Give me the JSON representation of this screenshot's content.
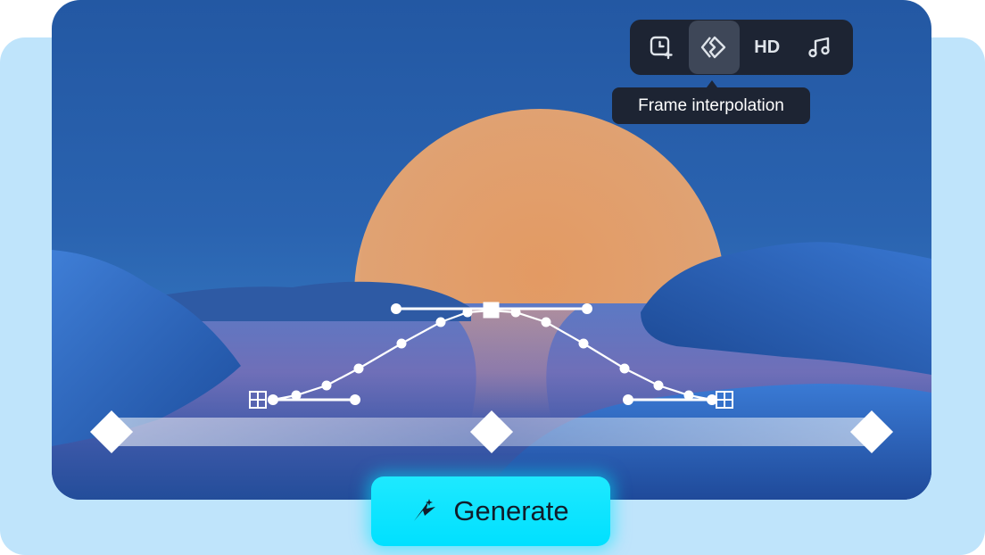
{
  "toolbar": {
    "items": [
      {
        "name": "timer-plus-icon"
      },
      {
        "name": "frame-interpolation-icon",
        "active": true
      },
      {
        "name": "hd-button",
        "label": "HD"
      },
      {
        "name": "music-icon"
      }
    ],
    "tooltip": "Frame interpolation"
  },
  "timeline": {
    "keyframes": 3
  },
  "generate": {
    "label": "Generate"
  },
  "colors": {
    "accent": "#00e0ff",
    "toolbar_bg": "#1d2433",
    "backdrop": "#bfe4fb",
    "sun": "#e3a06e"
  }
}
